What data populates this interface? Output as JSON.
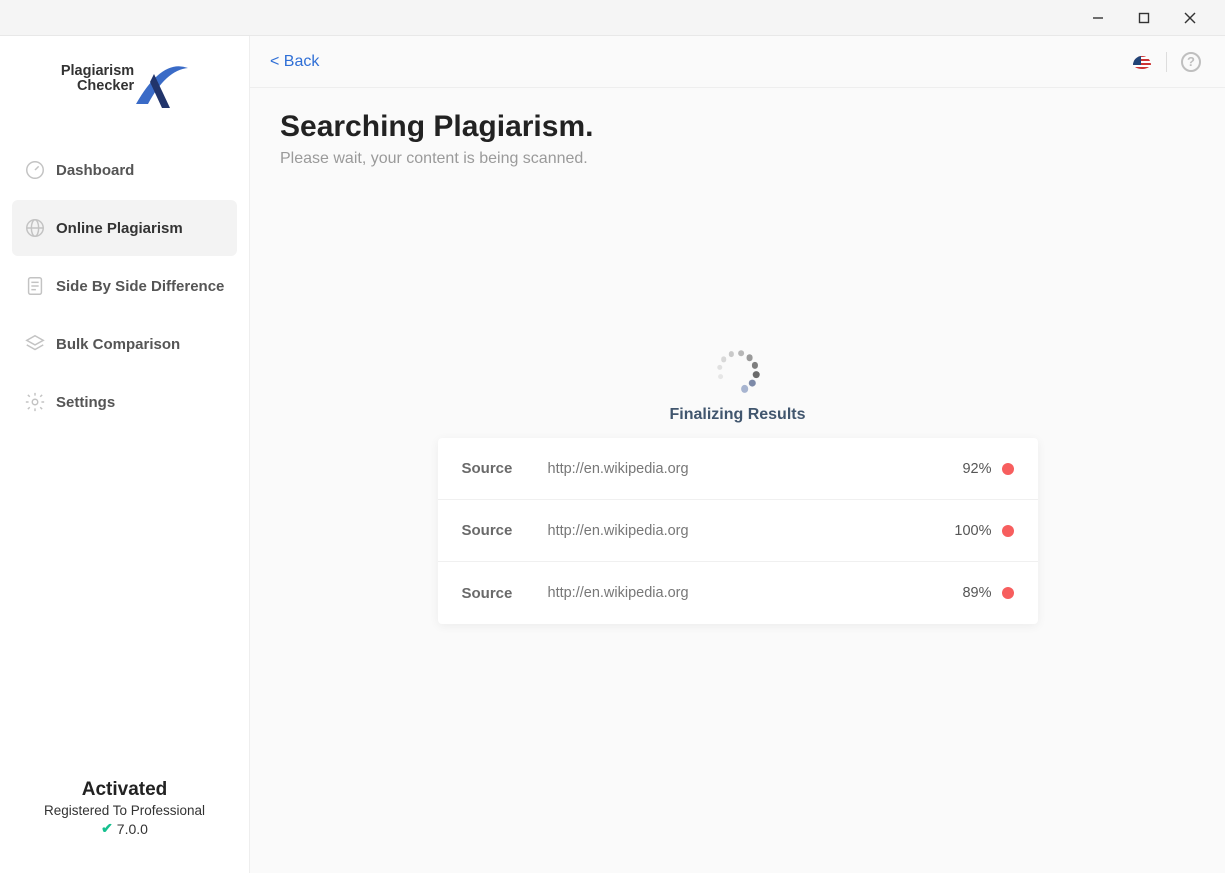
{
  "logo": {
    "line1": "Plagiarism",
    "line2": "Checker"
  },
  "sidebar": {
    "items": [
      {
        "label": "Dashboard",
        "icon": "gauge",
        "active": false
      },
      {
        "label": "Online Plagiarism",
        "icon": "globe",
        "active": true
      },
      {
        "label": "Side By Side Difference",
        "icon": "doc",
        "active": false
      },
      {
        "label": "Bulk Comparison",
        "icon": "stack",
        "active": false
      },
      {
        "label": "Settings",
        "icon": "gear",
        "active": false
      }
    ],
    "footer": {
      "activated": "Activated",
      "registered": "Registered To Professional",
      "version": "7.0.0"
    }
  },
  "topbar": {
    "back": "<  Back"
  },
  "page": {
    "title": "Searching Plagiarism.",
    "subtitle": "Please wait, your content is being scanned.",
    "status": "Finalizing Results",
    "source_label": "Source",
    "results": [
      {
        "url": "http://en.wikipedia.org",
        "percent": "92%",
        "color": "#f75e5e"
      },
      {
        "url": "http://en.wikipedia.org",
        "percent": "100%",
        "color": "#f75e5e"
      },
      {
        "url": "http://en.wikipedia.org",
        "percent": "89%",
        "color": "#f75e5e"
      }
    ]
  }
}
